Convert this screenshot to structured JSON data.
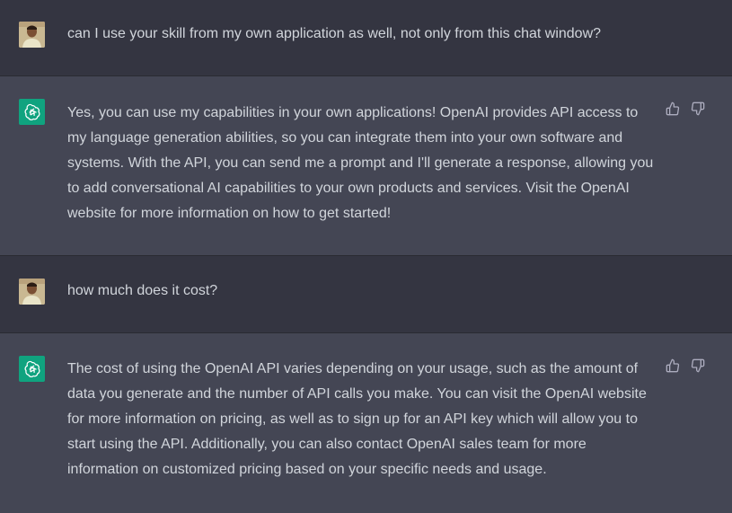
{
  "conversation": [
    {
      "role": "user",
      "avatar_icon": "user-photo-avatar",
      "text": "can I use your skill from my own application as well, not only from this chat window?"
    },
    {
      "role": "assistant",
      "avatar_icon": "openai-logo-icon",
      "text": "Yes, you can use my capabilities in your own applications! OpenAI provides API access to my language generation abilities, so you can integrate them into your own software and systems. With the API, you can send me a prompt and I'll generate a response, allowing you to add conversational AI capabilities to your own products and services. Visit the OpenAI website for more information on how to get started!",
      "feedback_icons": [
        "thumbs-up-icon",
        "thumbs-down-icon"
      ]
    },
    {
      "role": "user",
      "avatar_icon": "user-photo-avatar",
      "text": "how much does it cost?"
    },
    {
      "role": "assistant",
      "avatar_icon": "openai-logo-icon",
      "text": "The cost of using the OpenAI API varies depending on your usage, such as the amount of data you generate and the number of API calls you make. You can visit the OpenAI website for more information on pricing, as well as to sign up for an API key which will allow you to start using the API. Additionally, you can also contact OpenAI sales team for more information on customized pricing based on your specific needs and usage.",
      "feedback_icons": [
        "thumbs-up-icon",
        "thumbs-down-icon"
      ]
    }
  ],
  "colors": {
    "user_bg": "#343541",
    "assistant_bg": "#444654",
    "text": "#d1d5db",
    "openai_green": "#10a37f",
    "icon": "#acacbe"
  }
}
